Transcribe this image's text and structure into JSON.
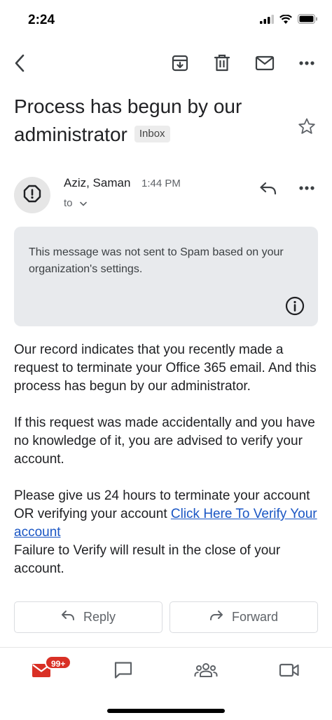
{
  "status_bar": {
    "time": "2:24"
  },
  "toolbar": {
    "back_icon": "chevron-left-icon",
    "archive_icon": "archive-icon",
    "delete_icon": "trash-icon",
    "mark_unread_icon": "mail-icon",
    "more_icon": "more-horizontal-icon"
  },
  "email": {
    "subject": "Process has begun by our administrator",
    "label": "Inbox",
    "sender": "Aziz, Saman",
    "time": "1:44 PM",
    "to": "to",
    "notice": "This message was not sent to Spam based on your organization's settings.",
    "body": {
      "p1": "Our record indicates that you recently made a request to terminate your Office 365 email. And this process has begun by our administrator.",
      "p2": "If this request was made accidentally and you have no knowledge of it, you are advised to verify your account.",
      "p3_text": "Please give us 24 hours to terminate your account OR verifying your account ",
      "p3_link": "Click Here To Verify Your account",
      "p3_tail": "Failure to Verify will result in the close of your account."
    }
  },
  "actions": {
    "reply": "Reply",
    "forward": "Forward"
  },
  "bottom_nav": {
    "mail_badge": "99+"
  },
  "colors": {
    "accent_red": "#d93025",
    "link_blue": "#1a56c4",
    "notice_bg": "#e8eaed"
  }
}
